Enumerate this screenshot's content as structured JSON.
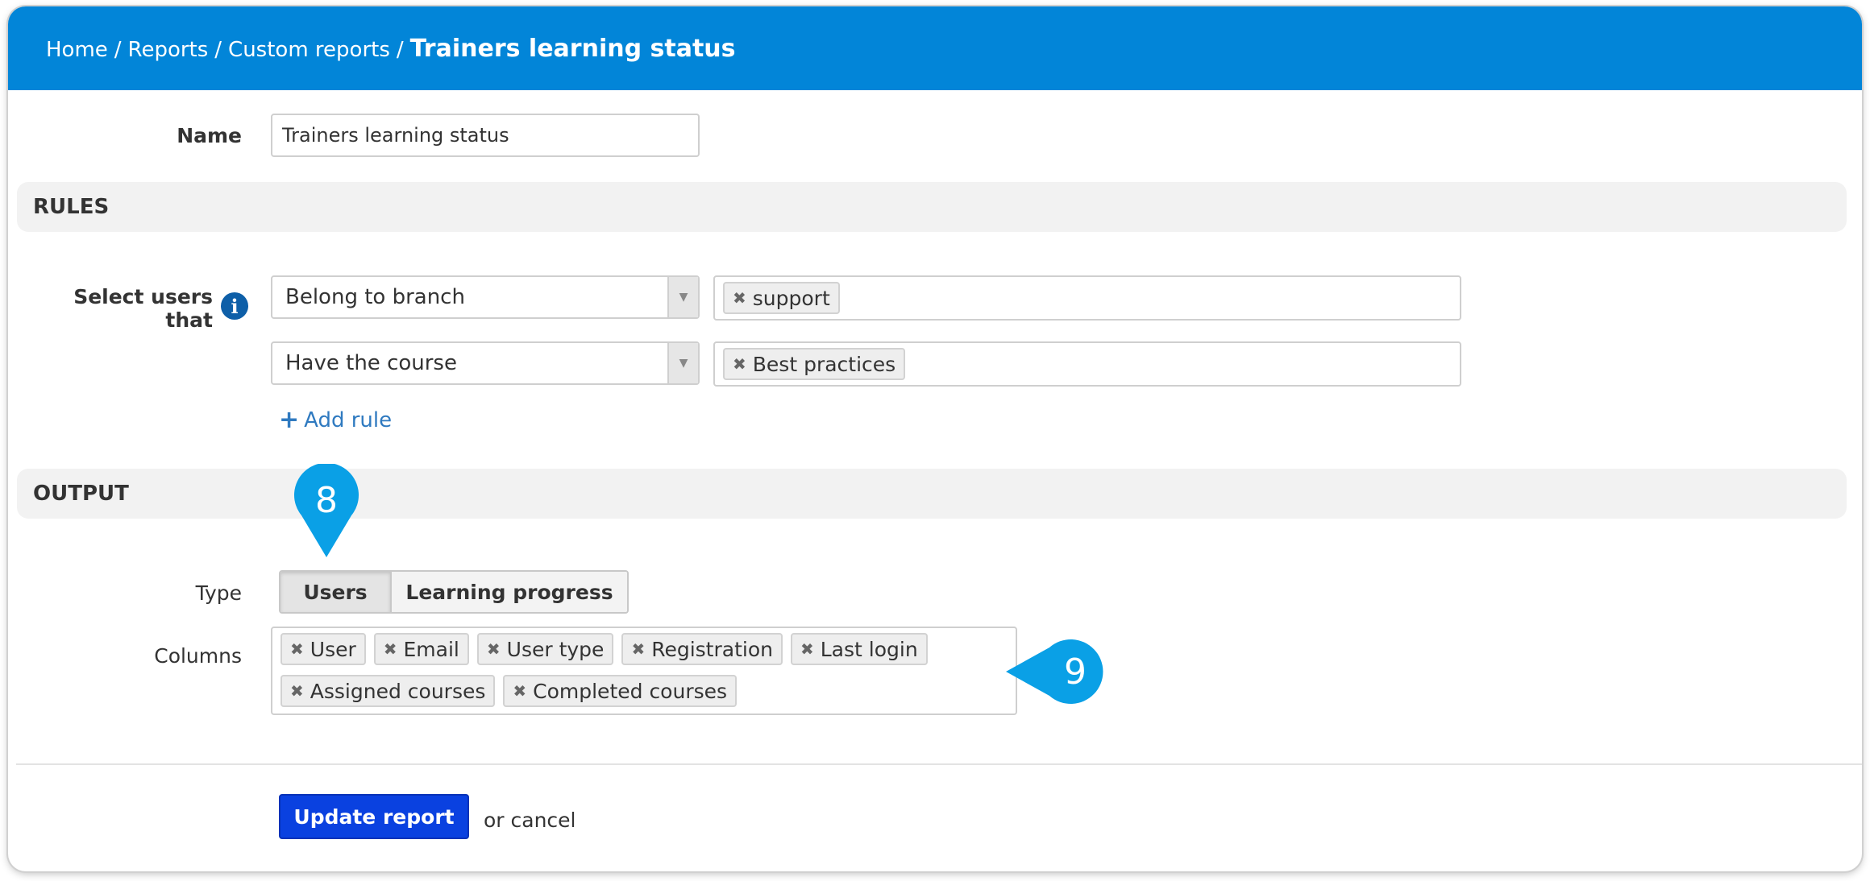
{
  "breadcrumb": {
    "items": [
      "Home",
      "Reports",
      "Custom reports"
    ],
    "separator": "/",
    "current": "Trainers learning status"
  },
  "name_field": {
    "label": "Name",
    "value": "Trainers learning status"
  },
  "rules": {
    "heading": "RULES",
    "label": "Select users that",
    "rows": [
      {
        "condition": "Belong to branch",
        "tags": [
          "support"
        ]
      },
      {
        "condition": "Have the course",
        "tags": [
          "Best practices"
        ]
      }
    ],
    "add_rule_label": "Add rule"
  },
  "output": {
    "heading": "OUTPUT",
    "type_label": "Type",
    "type_options": [
      "Users",
      "Learning progress"
    ],
    "type_selected": "Users",
    "columns_label": "Columns",
    "columns": [
      "User",
      "Email",
      "User type",
      "Registration",
      "Last login",
      "Assigned courses",
      "Completed courses"
    ]
  },
  "actions": {
    "submit_label": "Update report",
    "cancel_label": "or cancel"
  },
  "callouts": [
    "8",
    "9"
  ],
  "colors": {
    "header_bg": "#0285d8",
    "primary_button": "#0a41e0",
    "link": "#2f7ac0",
    "callout": "#0aa0e6"
  }
}
